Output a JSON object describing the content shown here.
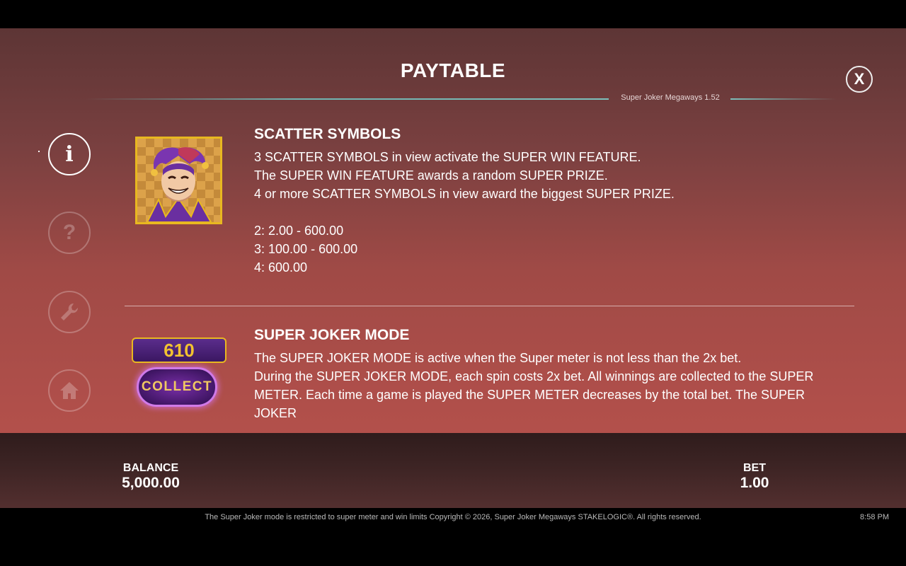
{
  "header": {
    "title": "PAYTABLE",
    "version": "Super Joker Megaways 1.52",
    "close_label": "X"
  },
  "sidebar": {
    "items": [
      {
        "icon": "info-icon",
        "glyph": "i",
        "active": true
      },
      {
        "icon": "help-icon",
        "glyph": "?",
        "active": false
      },
      {
        "icon": "settings-icon",
        "glyph": "wrench",
        "active": false
      },
      {
        "icon": "home-icon",
        "glyph": "house",
        "active": false
      }
    ]
  },
  "scatter": {
    "heading": "SCATTER SYMBOLS",
    "lines": [
      "3 SCATTER SYMBOLS in view activate the SUPER WIN FEATURE.",
      "The SUPER WIN FEATURE awards a random SUPER PRIZE.",
      "4 or more SCATTER SYMBOLS in view award the biggest SUPER PRIZE."
    ],
    "pays": [
      "2: 2.00 - 600.00",
      "3: 100.00 - 600.00",
      "4: 600.00"
    ],
    "symbol_icon": "joker-icon"
  },
  "super_joker": {
    "heading": "SUPER JOKER MODE",
    "meter_value": "610",
    "collect_label": "COLLECT",
    "lines": [
      "The SUPER JOKER MODE is active when the Super meter is not less than the 2x bet.",
      "During the SUPER JOKER MODE, each spin costs 2x bet. All winnings are collected to the SUPER",
      "METER. Each time a game is played the SUPER METER decreases by the total bet. The SUPER JOKER"
    ]
  },
  "bottom": {
    "balance_label": "BALANCE",
    "balance_value": "5,000.00",
    "bet_label": "BET",
    "bet_value": "1.00"
  },
  "footer": {
    "text": "The Super Joker mode is restricted to super meter and win limits Copyright © 2026, Super Joker Megaways STAKELOGIC®. All rights reserved.",
    "time": "8:58 PM"
  },
  "colors": {
    "gold": "#e8b820",
    "teal_line": "#7cc0bc",
    "purple": "#5b2d8c"
  }
}
